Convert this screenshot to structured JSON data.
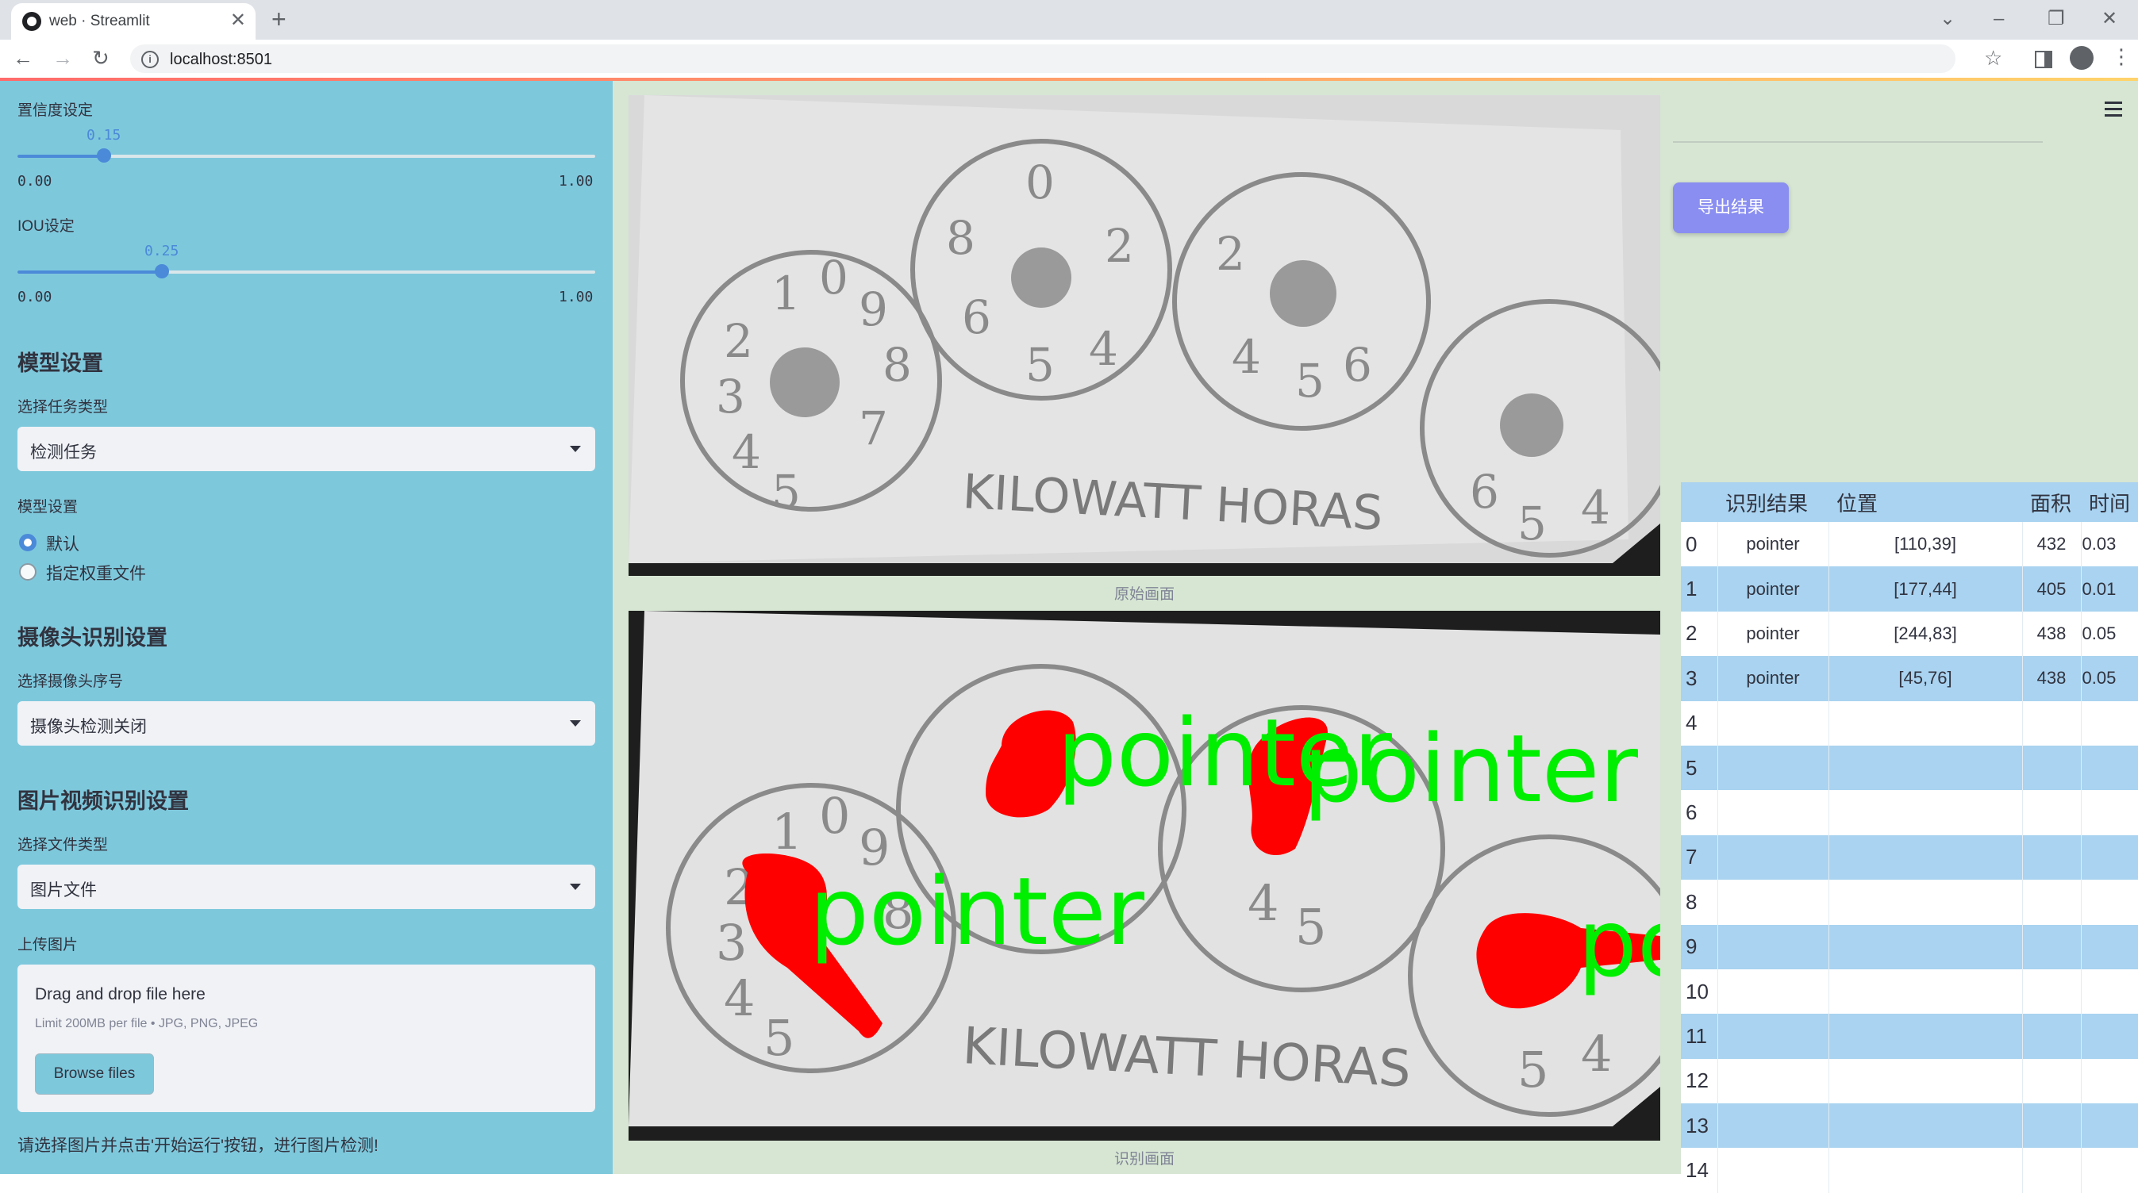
{
  "browser": {
    "tab_title": "web · Streamlit",
    "url": "localhost:8501",
    "new_tab": "+",
    "close": "✕"
  },
  "sidebar": {
    "confidence_label": "置信度设定",
    "confidence_value": "0.15",
    "confidence_fraction": 0.15,
    "confidence_min": "0.00",
    "confidence_max": "1.00",
    "iou_label": "IOU设定",
    "iou_value": "0.25",
    "iou_fraction": 0.25,
    "iou_min": "0.00",
    "iou_max": "1.00",
    "model_heading": "模型设置",
    "task_label": "选择任务类型",
    "task_value": "检测任务",
    "model_label": "模型设置",
    "radio_default": "默认",
    "radio_custom": "指定权重文件",
    "camera_heading": "摄像头识别设置",
    "camera_label": "选择摄像头序号",
    "camera_value": "摄像头检测关闭",
    "media_heading": "图片视频识别设置",
    "filetype_label": "选择文件类型",
    "filetype_value": "图片文件",
    "upload_label": "上传图片",
    "upload_title": "Drag and drop file here",
    "upload_limit": "Limit 200MB per file • JPG, PNG, JPEG",
    "browse_label": "Browse files",
    "hint": "请选择图片并点击'开始运行'按钮，进行图片检测!"
  },
  "main": {
    "caption_original": "原始画面",
    "caption_result": "识别画面",
    "export_label": "导出结果",
    "detection_label": "pointer",
    "meter_text": "KILOWATT HORAS"
  },
  "table": {
    "headers": [
      "识别结果",
      "位置",
      "面积",
      "时间"
    ],
    "rows": [
      {
        "idx": "0",
        "label": "pointer",
        "pos": "[110,39]",
        "area": "432",
        "time": "0.03"
      },
      {
        "idx": "1",
        "label": "pointer",
        "pos": "[177,44]",
        "area": "405",
        "time": "0.01"
      },
      {
        "idx": "2",
        "label": "pointer",
        "pos": "[244,83]",
        "area": "438",
        "time": "0.05"
      },
      {
        "idx": "3",
        "label": "pointer",
        "pos": "[45,76]",
        "area": "438",
        "time": "0.05"
      },
      {
        "idx": "4",
        "label": "",
        "pos": "",
        "area": "",
        "time": ""
      },
      {
        "idx": "5",
        "label": "",
        "pos": "",
        "area": "",
        "time": ""
      },
      {
        "idx": "6",
        "label": "",
        "pos": "",
        "area": "",
        "time": ""
      },
      {
        "idx": "7",
        "label": "",
        "pos": "",
        "area": "",
        "time": ""
      },
      {
        "idx": "8",
        "label": "",
        "pos": "",
        "area": "",
        "time": ""
      },
      {
        "idx": "9",
        "label": "",
        "pos": "",
        "area": "",
        "time": ""
      },
      {
        "idx": "10",
        "label": "",
        "pos": "",
        "area": "",
        "time": ""
      },
      {
        "idx": "11",
        "label": "",
        "pos": "",
        "area": "",
        "time": ""
      },
      {
        "idx": "12",
        "label": "",
        "pos": "",
        "area": "",
        "time": ""
      },
      {
        "idx": "13",
        "label": "",
        "pos": "",
        "area": "",
        "time": ""
      },
      {
        "idx": "14",
        "label": "",
        "pos": "",
        "area": "",
        "time": ""
      }
    ]
  }
}
